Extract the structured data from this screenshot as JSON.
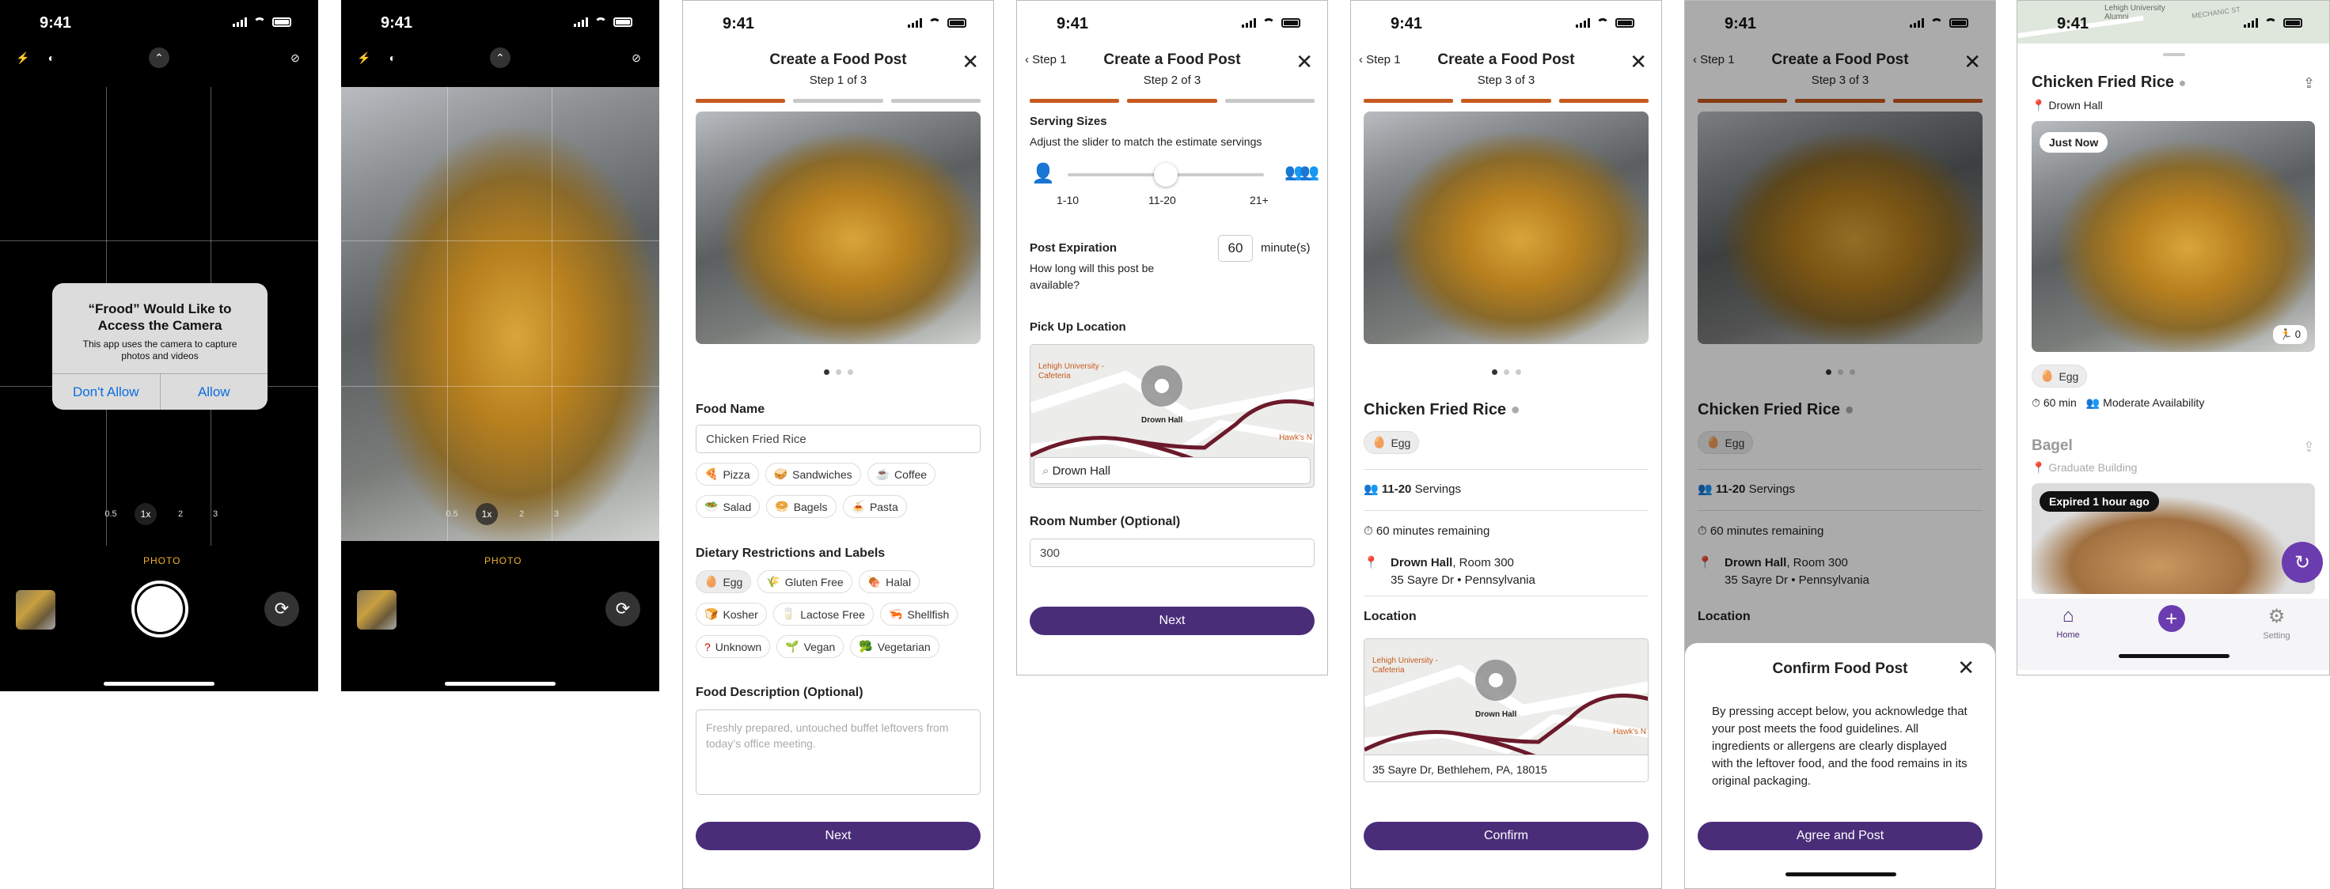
{
  "status": {
    "time": "9:41"
  },
  "camera": {
    "alert_title": "“Frood” Would Like to Access the Camera",
    "alert_body": "This app uses the camera to capture photos and videos",
    "dont_allow": "Don't Allow",
    "allow": "Allow",
    "zoom": [
      "0.5",
      "1x",
      "2",
      "3"
    ],
    "mode": "PHOTO"
  },
  "step1": {
    "title": "Create a Food Post",
    "step": "Step 1 of 3",
    "food_name_label": "Food Name",
    "food_name_value": "Chicken Fried Rice",
    "food_chips": [
      "Pizza",
      "Sandwiches",
      "Coffee",
      "Salad",
      "Bagels",
      "Pasta"
    ],
    "diet_label": "Dietary Restrictions and Labels",
    "diet_chips": [
      "Egg",
      "Gluten Free",
      "Halal",
      "Kosher",
      "Lactose Free",
      "Shellfish",
      "Unknown",
      "Vegan",
      "Vegetarian"
    ],
    "desc_label": "Food Description (Optional)",
    "desc_placeholder": "Freshly prepared, untouched buffet leftovers from today’s office meeting.",
    "next": "Next"
  },
  "step2": {
    "back": "Step 1",
    "title": "Create a Food Post",
    "step": "Step 2 of 3",
    "serving_label": "Serving Sizes",
    "serving_hint": "Adjust the slider to match the estimate servings",
    "ticks": [
      "1-10",
      "11-20",
      "21+"
    ],
    "serving_value": 0.5,
    "exp_label": "Post Expiration",
    "exp_hint": "How long will this post be available?",
    "exp_value": "60",
    "exp_unit": "minute(s)",
    "pickup_label": "Pick Up Location",
    "map_labels": {
      "lehigh": "Lehigh University - Cafeteria",
      "pin": "Drown Hall",
      "hawk": "Hawk's N"
    },
    "pickup_value": "Drown Hall",
    "room_label": "Room Number (Optional)",
    "room_value": "300",
    "next": "Next"
  },
  "step3": {
    "back": "Step 1",
    "title": "Create a Food Post",
    "step": "Step 3 of 3",
    "food_name": "Chicken Fried Rice",
    "tag": "Egg",
    "servings_range": "11-20",
    "servings_word": "Servings",
    "remaining": "60 minutes remaining",
    "building": "Drown Hall",
    "room": ", Room 300",
    "address": "35 Sayre Dr • Pennsylvania",
    "location_label": "Location",
    "full_address": "35 Sayre Dr, Bethlehem, PA, 18015",
    "confirm": "Confirm"
  },
  "confirm_sheet": {
    "title": "Confirm Food Post",
    "body": "By pressing accept below, you acknowledge that your post meets the food guidelines. All ingredients or allergens are clearly displayed with the leftover food, and the food remains in its original packaging.",
    "agree": "Agree and Post"
  },
  "feed": {
    "map_text": "Lehigh University Alumni",
    "street": "MECHANIC ST",
    "post1": {
      "title": "Chicken Fried Rice",
      "location": "Drown Hall",
      "badge": "Just Now",
      "count": "0",
      "tag": "Egg",
      "time": "60 min",
      "availability": "Moderate Availability"
    },
    "post2": {
      "title": "Bagel",
      "location": "Graduate Building",
      "badge": "Expired 1 hour ago"
    },
    "nav": [
      "Home",
      "Setting"
    ]
  },
  "colors": {
    "accent": "#4a2d79",
    "progress": "#c65a1e",
    "maroon": "#6b1a2b"
  }
}
